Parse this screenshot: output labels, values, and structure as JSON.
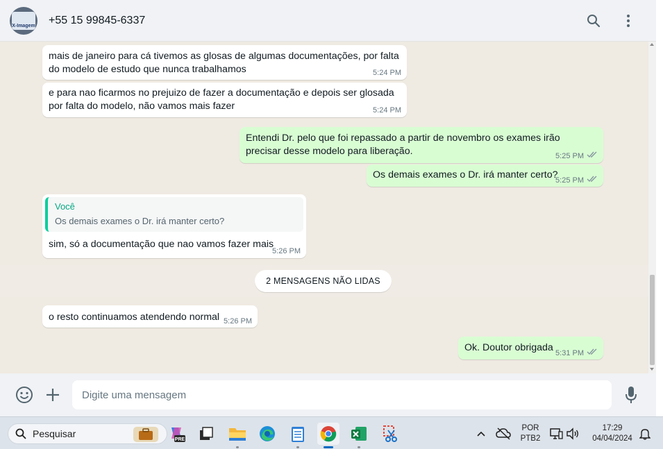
{
  "header": {
    "contact_name": "+55 15 99845-6337",
    "avatar_text": "X-Imagem"
  },
  "messages": [
    {
      "text": "mais de janeiro para cá tivemos as glosas de algumas documentações, por falta do modelo de estudo que nunca trabalhamos",
      "time": "5:24 PM",
      "direction": "incoming"
    },
    {
      "text": "e para nao ficarmos no prejuizo de fazer a documentação e depois ser glosada por falta do modelo, não vamos mais fazer",
      "time": "5:24 PM",
      "direction": "incoming"
    },
    {
      "text": "Entendi Dr. pelo que foi repassado a partir de novembro os exames irão precisar desse modelo para liberação.",
      "time": "5:25 PM",
      "direction": "outgoing"
    },
    {
      "text": "Os demais exames o Dr. irá manter certo?",
      "time": "5:25 PM",
      "direction": "outgoing"
    },
    {
      "text": "sim, só a documentação que nao vamos fazer mais",
      "time": "5:26 PM",
      "direction": "incoming",
      "quote": {
        "author": "Você",
        "text": "Os demais exames o Dr. irá manter certo?"
      }
    },
    {
      "text": "o resto continuamos atendendo normal",
      "time": "5:26 PM",
      "direction": "incoming"
    },
    {
      "text": "Ok. Doutor obrigada",
      "time": "5:31 PM",
      "direction": "outgoing"
    }
  ],
  "unread_divider": "2 MENSAGENS NÃO LIDAS",
  "composer": {
    "placeholder": "Digite uma mensagem"
  },
  "taskbar": {
    "search_label": "Pesquisar",
    "language": "POR",
    "layout": "PTB2",
    "time": "17:29",
    "date": "04/04/2024"
  },
  "colors": {
    "incoming_bubble": "#ffffff",
    "outgoing_bubble": "#d9fdd3",
    "chat_background": "#efeae2",
    "accent": "#06cf9c"
  }
}
